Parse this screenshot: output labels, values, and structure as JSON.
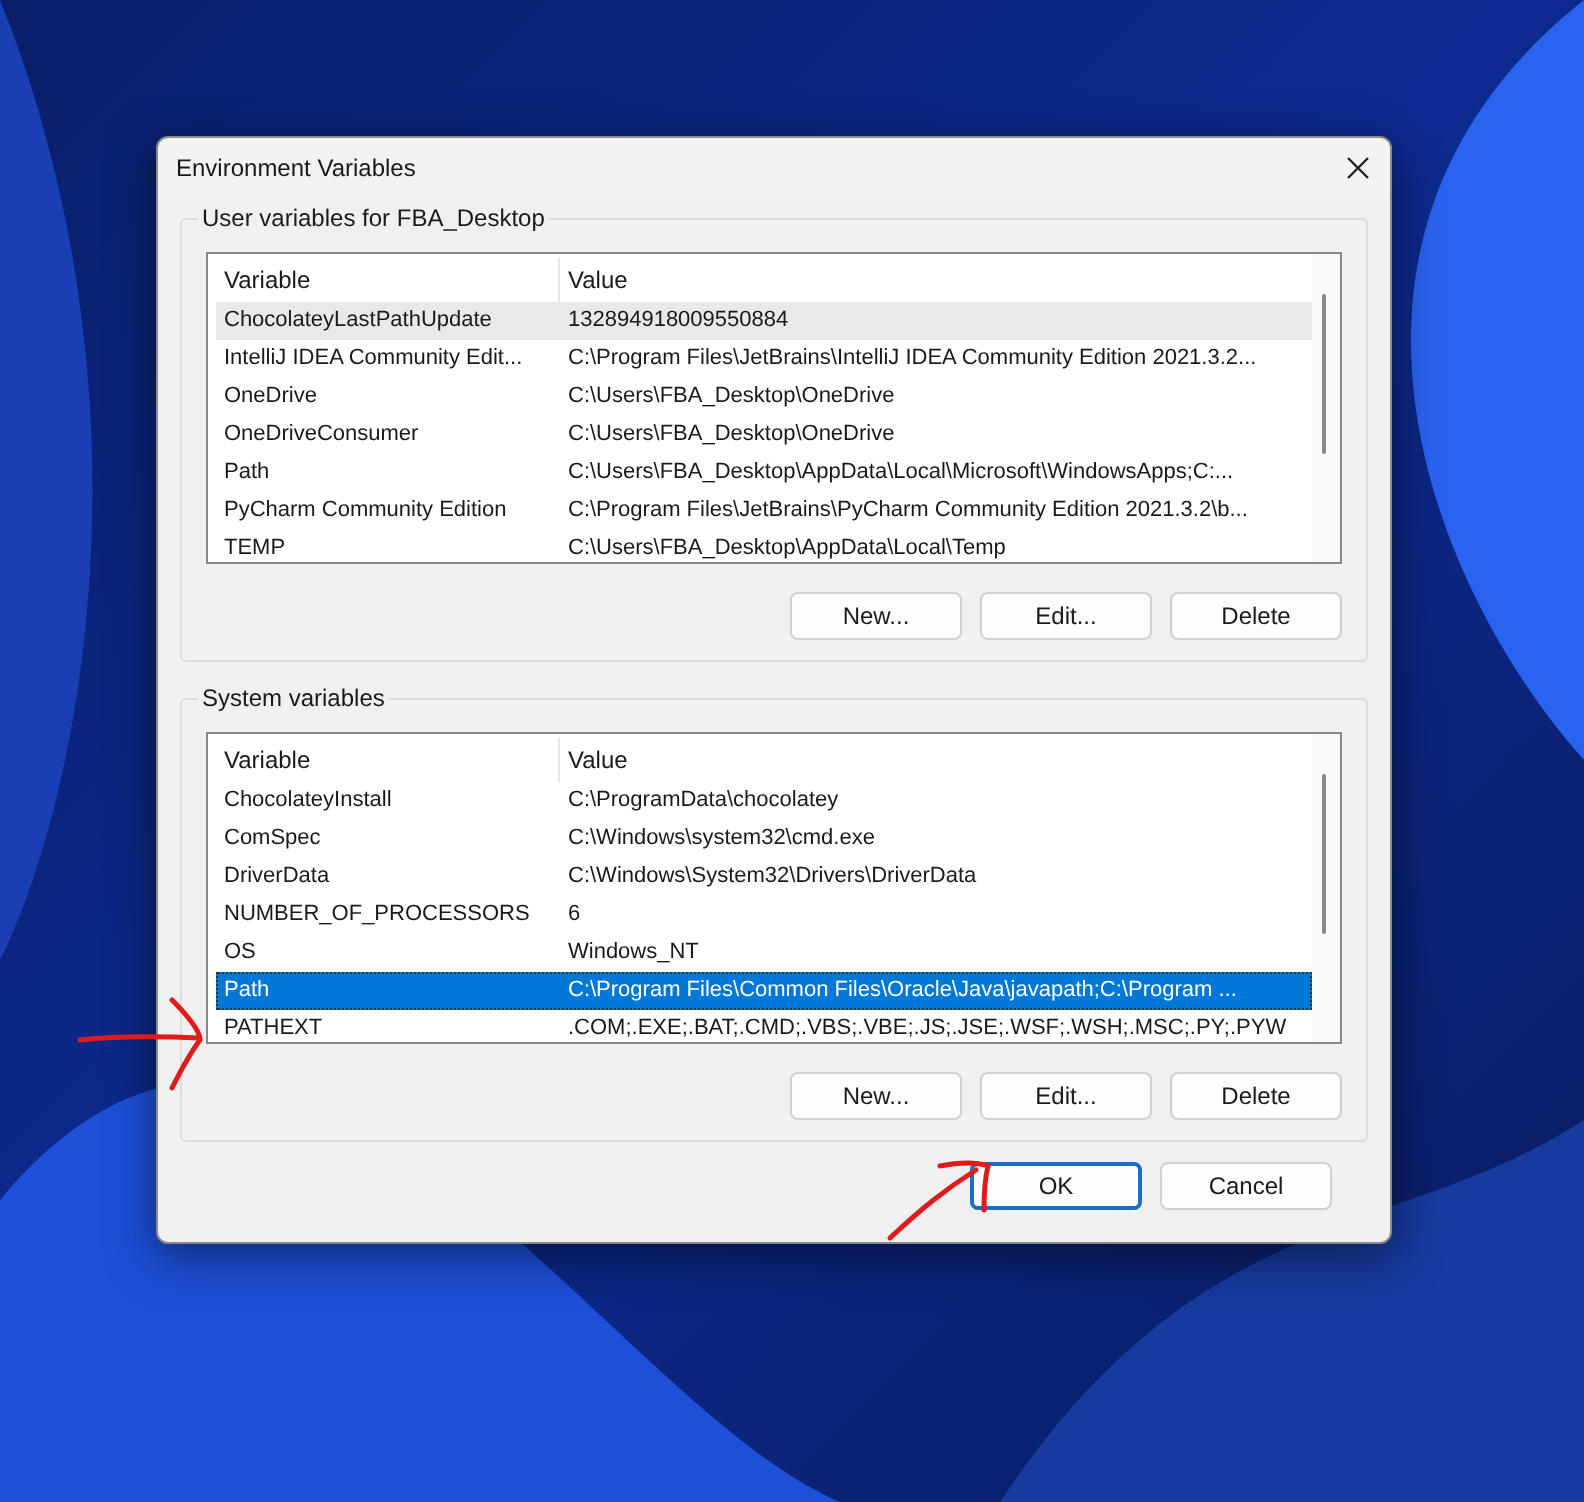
{
  "window": {
    "title": "Environment Variables"
  },
  "groups": [
    {
      "title": "User variables for FBA_Desktop",
      "focused": false,
      "columns": [
        "Variable",
        "Value"
      ],
      "rows": [
        {
          "variable": "ChocolateyLastPathUpdate",
          "value": "132894918009550884",
          "selected": true
        },
        {
          "variable": "IntelliJ IDEA Community Edit...",
          "value": "C:\\Program Files\\JetBrains\\IntelliJ IDEA Community Edition 2021.3.2...",
          "selected": false
        },
        {
          "variable": "OneDrive",
          "value": "C:\\Users\\FBA_Desktop\\OneDrive",
          "selected": false
        },
        {
          "variable": "OneDriveConsumer",
          "value": "C:\\Users\\FBA_Desktop\\OneDrive",
          "selected": false
        },
        {
          "variable": "Path",
          "value": "C:\\Users\\FBA_Desktop\\AppData\\Local\\Microsoft\\WindowsApps;C:...",
          "selected": false
        },
        {
          "variable": "PyCharm Community Edition",
          "value": "C:\\Program Files\\JetBrains\\PyCharm Community Edition 2021.3.2\\b...",
          "selected": false
        },
        {
          "variable": "TEMP",
          "value": "C:\\Users\\FBA_Desktop\\AppData\\Local\\Temp",
          "selected": false
        }
      ],
      "buttons": [
        "New...",
        "Edit...",
        "Delete"
      ]
    },
    {
      "title": "System variables",
      "focused": true,
      "columns": [
        "Variable",
        "Value"
      ],
      "rows": [
        {
          "variable": "ChocolateyInstall",
          "value": "C:\\ProgramData\\chocolatey",
          "selected": false
        },
        {
          "variable": "ComSpec",
          "value": "C:\\Windows\\system32\\cmd.exe",
          "selected": false
        },
        {
          "variable": "DriverData",
          "value": "C:\\Windows\\System32\\Drivers\\DriverData",
          "selected": false
        },
        {
          "variable": "NUMBER_OF_PROCESSORS",
          "value": "6",
          "selected": false
        },
        {
          "variable": "OS",
          "value": "Windows_NT",
          "selected": false
        },
        {
          "variable": "Path",
          "value": "C:\\Program Files\\Common Files\\Oracle\\Java\\javapath;C:\\Program ...",
          "selected": true
        },
        {
          "variable": "PATHEXT",
          "value": ".COM;.EXE;.BAT;.CMD;.VBS;.VBE;.JS;.JSE;.WSF;.WSH;.MSC;.PY;.PYW",
          "selected": false
        }
      ],
      "buttons": [
        "New...",
        "Edit...",
        "Delete"
      ]
    }
  ],
  "footer_buttons": [
    {
      "label": "OK",
      "default": true
    },
    {
      "label": "Cancel",
      "default": false
    }
  ]
}
